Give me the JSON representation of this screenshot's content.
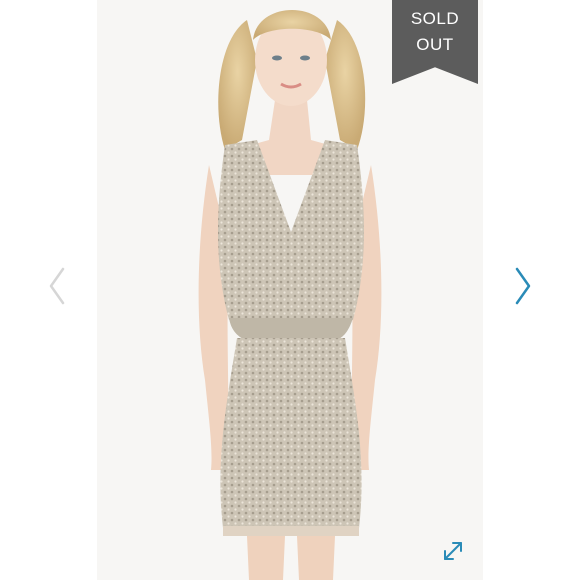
{
  "listing": {
    "badge": {
      "line1": "SOLD",
      "line2": "OUT",
      "color": "#5c5c5c"
    },
    "photo": {
      "subject": "beaded-blouson-dress",
      "dress_color": "#cbc3b4",
      "backdrop_color": "#f7f6f4"
    }
  },
  "controls": {
    "previous_icon": "chevron-left-icon",
    "next_icon": "chevron-right-icon",
    "expand_icon": "expand-arrows-icon",
    "inactive_color": "#d6d6d6",
    "accent_color": "#2a8bb7"
  }
}
